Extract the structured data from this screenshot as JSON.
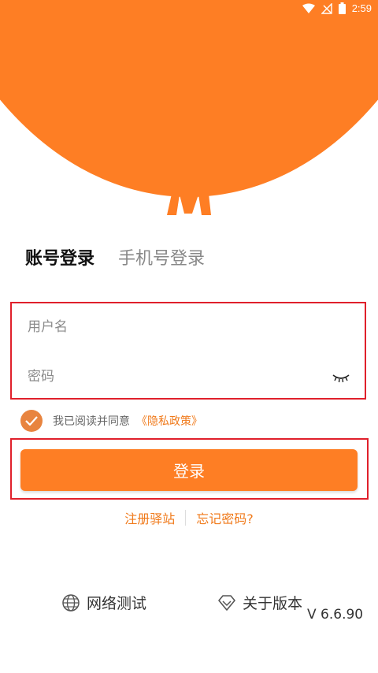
{
  "status_bar": {
    "time": "2:59"
  },
  "colors": {
    "brand": "#fe7e24",
    "link": "#f07a1b",
    "highlight_border": "#e0202b"
  },
  "tabs": [
    {
      "label": "账号登录",
      "active": true
    },
    {
      "label": "手机号登录",
      "active": false
    }
  ],
  "form": {
    "username_placeholder": "用户名",
    "password_placeholder": "密码"
  },
  "agreement": {
    "text": "我已阅读并同意",
    "policy_link": "《隐私政策》",
    "checked": true
  },
  "login_button": {
    "label": "登录"
  },
  "links": {
    "register": "注册驿站",
    "forgot": "忘记密码?"
  },
  "bottom": {
    "network_test": "网络测试",
    "about_version": "关于版本",
    "version": "V 6.6.90"
  },
  "icons": [
    "wifi-icon",
    "signal-icon",
    "battery-icon",
    "eye-closed-icon",
    "check-icon",
    "globe-icon",
    "diamond-icon",
    "logo-m-icon"
  ]
}
